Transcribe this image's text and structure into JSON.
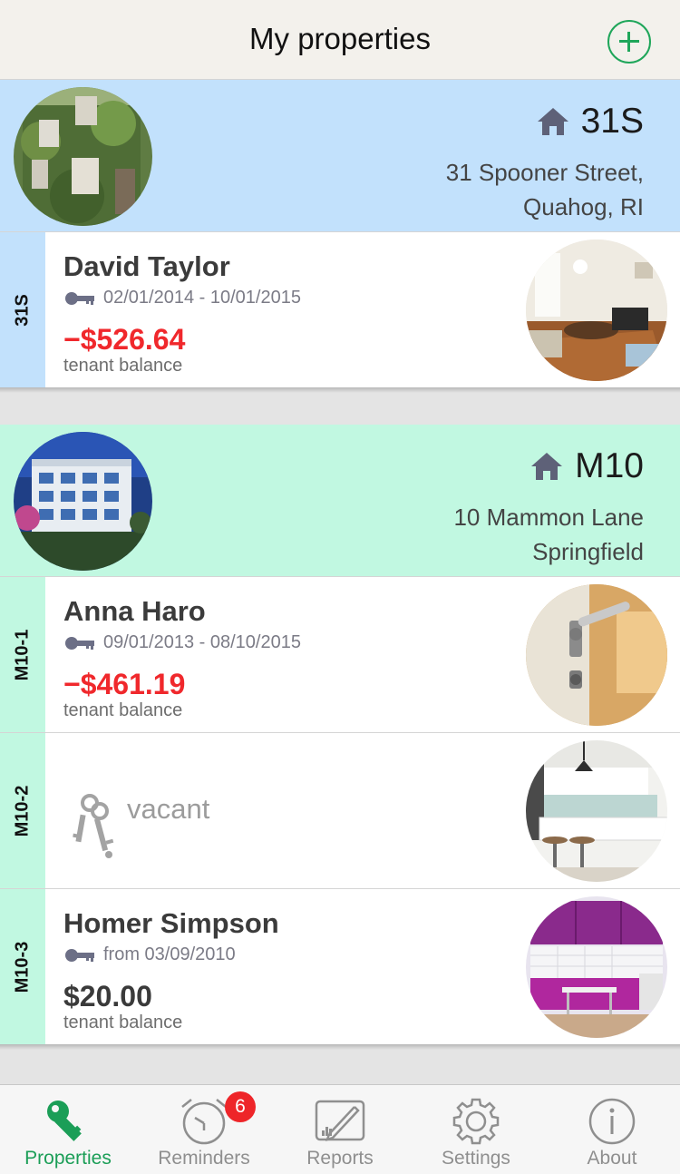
{
  "nav": {
    "title": "My properties",
    "add_icon": "plus-circle-icon"
  },
  "colors": {
    "accent_green": "#1fa65a",
    "header_blue": "#c2e1fc",
    "header_mint": "#c1f8e1",
    "negative_balance": "#f0282c",
    "badge_red": "#ee2529"
  },
  "properties": [
    {
      "code": "31S",
      "address_line1": "31 Spooner Street,",
      "address_line2": "Quahog, RI",
      "photo": "ivy-covered-building-photo",
      "units": [
        {
          "tag": "31S",
          "tenant": "David Taylor",
          "lease": "02/01/2014 - 10/01/2015",
          "balance": "−$526.64",
          "balance_label": "tenant balance",
          "photo": "living-room-photo"
        }
      ]
    },
    {
      "code": "M10",
      "address_line1": "10 Mammon Lane",
      "address_line2": "Springfield",
      "photo": "apartment-building-photo",
      "units": [
        {
          "tag": "M10-1",
          "tenant": "Anna Haro",
          "lease": "09/01/2013 - 08/10/2015",
          "balance": "−$461.19",
          "balance_label": "tenant balance",
          "photo": "door-handle-photo"
        },
        {
          "tag": "M10-2",
          "status": "vacant",
          "photo": "kitchen-photo"
        },
        {
          "tag": "M10-3",
          "tenant": "Homer Simpson",
          "lease": "from 03/09/2010",
          "balance": "$20.00",
          "balance_label": "tenant balance",
          "photo": "purple-kitchen-photo"
        }
      ]
    }
  ],
  "tabbar": {
    "tabs": [
      {
        "label": "Properties",
        "icon": "key-icon",
        "active": true
      },
      {
        "label": "Reminders",
        "icon": "alarm-clock-icon",
        "badge": "6"
      },
      {
        "label": "Reports",
        "icon": "report-chart-icon"
      },
      {
        "label": "Settings",
        "icon": "gear-icon"
      },
      {
        "label": "About",
        "icon": "info-icon"
      }
    ]
  }
}
